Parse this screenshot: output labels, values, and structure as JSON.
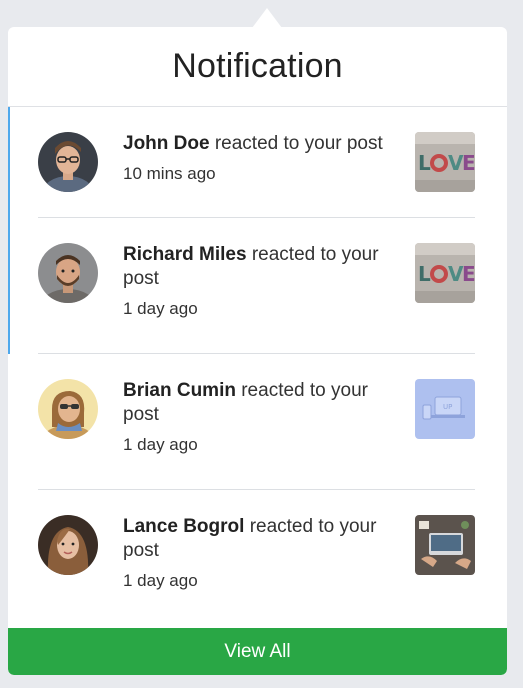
{
  "header": {
    "title": "Notification"
  },
  "notifications": [
    {
      "name": "John Doe",
      "action": "reacted to your post",
      "time": "10 mins ago",
      "avatar_icon": "user-avatar-man-glasses",
      "thumb_icon": "love-sign-image",
      "unread": true
    },
    {
      "name": "Richard Miles",
      "action": "reacted to your post",
      "time": "1 day ago",
      "avatar_icon": "user-avatar-man-beard",
      "thumb_icon": "love-sign-image",
      "unread": true
    },
    {
      "name": "Brian Cumin",
      "action": "reacted to your post",
      "time": "1 day ago",
      "avatar_icon": "user-avatar-woman-sunglasses",
      "thumb_icon": "devices-image",
      "unread": false
    },
    {
      "name": "Lance Bogrol",
      "action": "reacted to your post",
      "time": "1 day ago",
      "avatar_icon": "user-avatar-woman-hair",
      "thumb_icon": "desk-laptop-image",
      "unread": false
    }
  ],
  "footer": {
    "view_all_label": "View All"
  },
  "colors": {
    "accent_unread": "#4ea8ec",
    "button": "#29a745"
  }
}
